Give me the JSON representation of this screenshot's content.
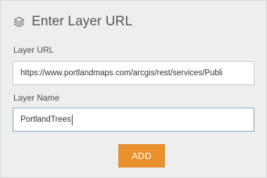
{
  "header": {
    "icon": "layers-icon",
    "title": "Enter Layer URL"
  },
  "form": {
    "url_label": "Layer URL",
    "url_value": "https://www.portlandmaps.com/arcgis/rest/services/Publi",
    "name_label": "Layer Name",
    "name_value": "PortlandTrees",
    "add_label": "ADD"
  },
  "colors": {
    "panel_background": "#eeeeee",
    "accent": "#e8912d",
    "focus_border": "#7ea1c5"
  }
}
